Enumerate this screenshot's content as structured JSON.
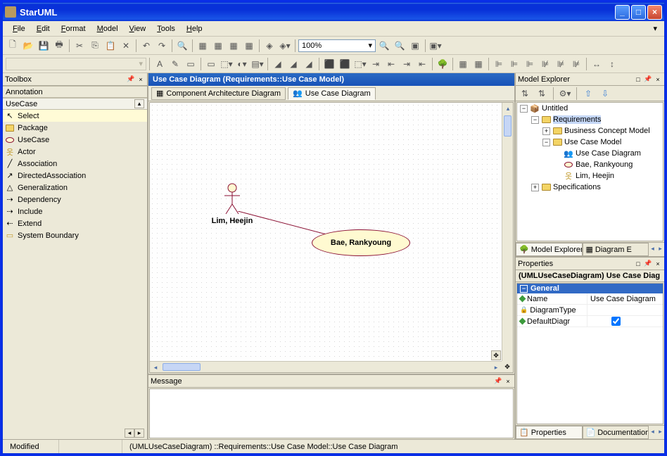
{
  "titlebar": {
    "title": "StarUML"
  },
  "menu": [
    "File",
    "Edit",
    "Format",
    "Model",
    "View",
    "Tools",
    "Help"
  ],
  "zoom": "100%",
  "toolbox": {
    "title": "Toolbox",
    "groups": {
      "annotation": "Annotation",
      "usecase": "UseCase"
    },
    "items": [
      "Select",
      "Package",
      "UseCase",
      "Actor",
      "Association",
      "DirectedAssociation",
      "Generalization",
      "Dependency",
      "Include",
      "Extend",
      "System Boundary"
    ]
  },
  "diagram": {
    "title": "Use Case Diagram (Requirements::Use Case Model)",
    "tabs": [
      "Component Architecture Diagram",
      "Use Case Diagram"
    ],
    "actor_label": "Lim, Heejin",
    "usecase_label": "Bae, Rankyoung"
  },
  "message": {
    "title": "Message"
  },
  "model_explorer": {
    "title": "Model Explorer",
    "tree": {
      "root": "Untitled",
      "requirements": "Requirements",
      "bcm": "Business Concept Model",
      "ucm": "Use Case Model",
      "ucd": "Use Case Diagram",
      "bae": "Bae, Rankyoung",
      "lim": "Lim, Heejin",
      "spec": "Specifications"
    },
    "tabs": [
      "Model Explorer",
      "Diagram E"
    ]
  },
  "properties": {
    "panel_title": "Properties",
    "title": "(UMLUseCaseDiagram) Use Case Diag",
    "category": "General",
    "rows": {
      "name": {
        "label": "Name",
        "value": "Use Case Diagram"
      },
      "type": {
        "label": "DiagramType",
        "value": ""
      },
      "default": {
        "label": "DefaultDiagr",
        "value": ""
      }
    },
    "tabs": [
      "Properties",
      "Documentation"
    ]
  },
  "status": {
    "modified": "Modified",
    "path": "(UMLUseCaseDiagram) ::Requirements::Use Case Model::Use Case Diagram"
  }
}
